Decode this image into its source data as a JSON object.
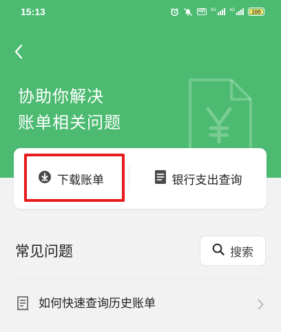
{
  "status_bar": {
    "time": "15:13",
    "hd_label": "HD",
    "signal1_label": "5G",
    "signal2_label": "4G",
    "battery": "100"
  },
  "header": {
    "back_icon": "chevron-left-icon",
    "title_line1": "协助你解决",
    "title_line2": "账单相关问题"
  },
  "card": {
    "download_label": "下载账单",
    "bank_query_label": "银行支出查询"
  },
  "faq": {
    "section_title": "常见问题",
    "search_label": "搜索",
    "items": [
      {
        "label": "如何快速查询历史账单"
      }
    ]
  },
  "colors": {
    "brand_green": "#4cbb71",
    "highlight_red": "#e8191b",
    "battery_yellow": "#f4e56b"
  }
}
